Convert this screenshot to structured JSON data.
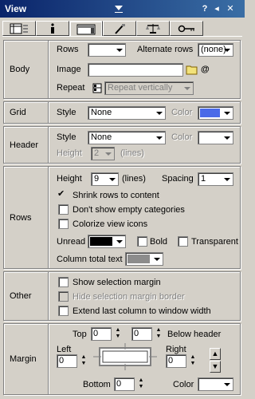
{
  "window": {
    "title": "View"
  },
  "tabs": [
    {
      "name": "tab-grid-view"
    },
    {
      "name": "tab-info"
    },
    {
      "name": "tab-view-options"
    },
    {
      "name": "tab-paint"
    },
    {
      "name": "tab-scale"
    },
    {
      "name": "tab-key"
    }
  ],
  "body": {
    "section_label": "Body",
    "rows_label": "Rows",
    "rows_value": "",
    "alternate_rows_label": "Alternate rows",
    "alternate_rows_value": "(none)",
    "image_label": "Image",
    "image_value": "",
    "image_at": "@",
    "repeat_label": "Repeat",
    "repeat_value": "Repeat vertically"
  },
  "grid": {
    "section_label": "Grid",
    "style_label": "Style",
    "style_value": "None",
    "color_label": "Color",
    "color_hex": "#4a6ae8"
  },
  "header": {
    "section_label": "Header",
    "style_label": "Style",
    "style_value": "None",
    "color_label": "Color",
    "height_label": "Height",
    "height_value": "2",
    "lines_label": "(lines)"
  },
  "rows": {
    "section_label": "Rows",
    "height_label": "Height",
    "height_value": "9",
    "lines_label": "(lines)",
    "spacing_label": "Spacing",
    "spacing_value": "1",
    "shrink_label": "Shrink rows to content",
    "shrink_checked": true,
    "empty_categories_label": "Don't show empty categories",
    "colorize_icons_label": "Colorize view icons",
    "unread_label": "Unread",
    "unread_color_hex": "#000000",
    "bold_label": "Bold",
    "transparent_label": "Transparent",
    "column_total_label": "Column total text",
    "column_total_color_hex": "#8c8c8c"
  },
  "other": {
    "section_label": "Other",
    "show_selection_label": "Show selection margin",
    "hide_selection_border_label": "Hide selection margin border",
    "extend_last_column_label": "Extend last column to window width"
  },
  "margin": {
    "section_label": "Margin",
    "top_label": "Top",
    "top_value": "0",
    "below_header_value": "0",
    "below_header_label": "Below header",
    "left_label": "Left",
    "left_value": "0",
    "right_label": "Right",
    "right_value": "0",
    "bottom_label": "Bottom",
    "bottom_value": "0",
    "color_label": "Color"
  }
}
